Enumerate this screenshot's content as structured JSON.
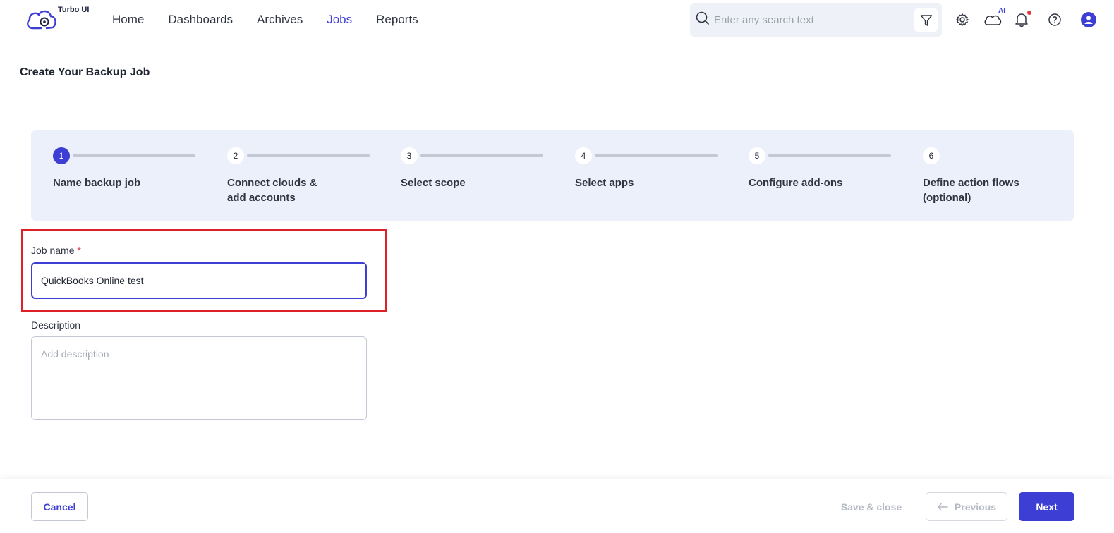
{
  "app": {
    "name": "Turbo UI"
  },
  "nav": {
    "items": [
      {
        "label": "Home",
        "active": false
      },
      {
        "label": "Dashboards",
        "active": false
      },
      {
        "label": "Archives",
        "active": false
      },
      {
        "label": "Jobs",
        "active": true
      },
      {
        "label": "Reports",
        "active": false
      }
    ]
  },
  "search": {
    "placeholder": "Enter any search text"
  },
  "top_icons": {
    "ai_label": "AI"
  },
  "page": {
    "title": "Create Your Backup Job"
  },
  "stepper": {
    "steps": [
      {
        "number": "1",
        "label": "Name backup job",
        "active": true
      },
      {
        "number": "2",
        "label": "Connect clouds & add accounts",
        "active": false
      },
      {
        "number": "3",
        "label": "Select scope",
        "active": false
      },
      {
        "number": "4",
        "label": "Select apps",
        "active": false
      },
      {
        "number": "5",
        "label": "Configure add-ons",
        "active": false
      },
      {
        "number": "6",
        "label": "Define action flows (optional)",
        "active": false
      }
    ]
  },
  "form": {
    "job_name": {
      "label": "Job name",
      "required_mark": "*",
      "value": "QuickBooks Online test"
    },
    "description": {
      "label": "Description",
      "placeholder": "Add description",
      "value": ""
    }
  },
  "footer": {
    "cancel_label": "Cancel",
    "save_close_label": "Save & close",
    "previous_label": "Previous",
    "next_label": "Next"
  },
  "colors": {
    "accent": "#3d3fd4",
    "highlight": "#de2127",
    "stepper_bg": "#ecf0fa",
    "notification_dot": "#e5343a"
  }
}
